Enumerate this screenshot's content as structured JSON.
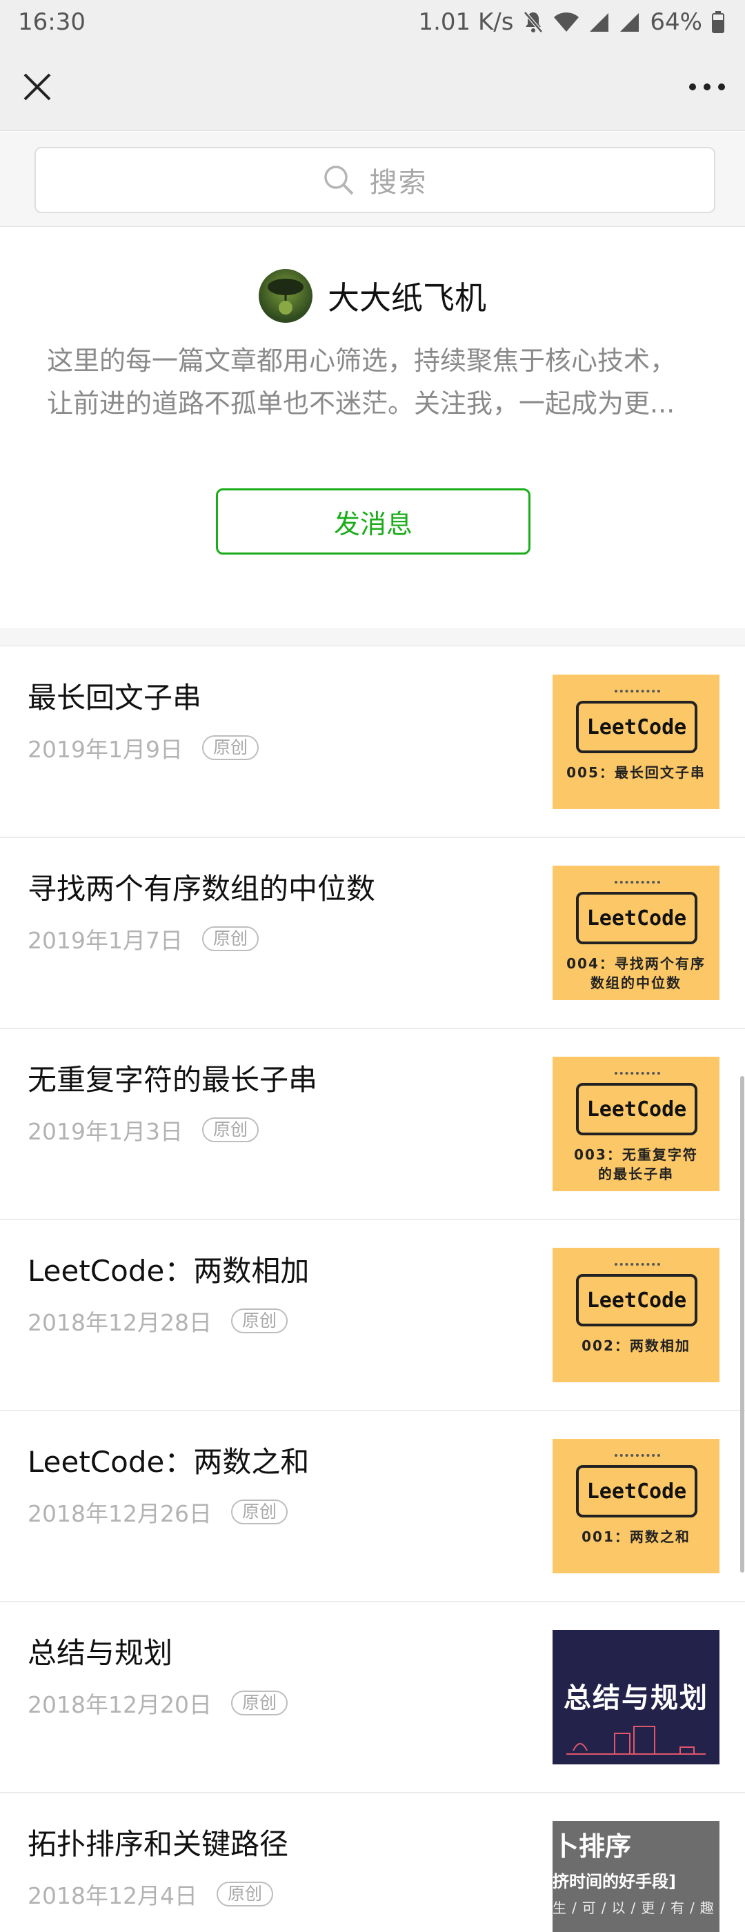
{
  "status_bar": {
    "time": "16:30",
    "network_speed": "1.01 K/s",
    "battery": "64%"
  },
  "nav": {
    "close_icon": "close-icon",
    "more_icon": "more-icon"
  },
  "search": {
    "placeholder": "搜索"
  },
  "profile": {
    "name": "大大纸飞机",
    "description_line1": "这里的每一篇文章都用心筛选，持续聚焦于核心技术，",
    "description_line2": "让前进的道路不孤单也不迷茫。关注我，一起成为更...",
    "message_button": "发消息",
    "accent_color": "#1aad19"
  },
  "articles": [
    {
      "title": "最长回文子串",
      "date": "2019年1月9日",
      "badge": "原创",
      "thumb": {
        "logo": "LeetCode",
        "caption_line1": "005：最长回文子串",
        "caption_line2": ""
      }
    },
    {
      "title": "寻找两个有序数组的中位数",
      "date": "2019年1月7日",
      "badge": "原创",
      "thumb": {
        "logo": "LeetCode",
        "caption_line1": "004：寻找两个有序",
        "caption_line2": "数组的中位数"
      }
    },
    {
      "title": "无重复字符的最长子串",
      "date": "2019年1月3日",
      "badge": "原创",
      "thumb": {
        "logo": "LeetCode",
        "caption_line1": "003：无重复字符",
        "caption_line2": "的最长子串"
      }
    },
    {
      "title": "LeetCode：两数相加",
      "date": "2018年12月28日",
      "badge": "原创",
      "thumb": {
        "logo": "LeetCode",
        "caption_line1": "002：两数相加",
        "caption_line2": ""
      }
    },
    {
      "title": "LeetCode：两数之和",
      "date": "2018年12月26日",
      "badge": "原创",
      "thumb": {
        "logo": "LeetCode",
        "caption_line1": "001：两数之和",
        "caption_line2": ""
      }
    },
    {
      "title": "总结与规划",
      "date": "2018年12月20日",
      "badge": "原创",
      "thumb": {
        "text": "总结与规划"
      }
    },
    {
      "title": "拓扑排序和关键路径",
      "date": "2018年12月4日",
      "badge": "原创",
      "thumb": {
        "text1": "卜排序",
        "text2": "挤时间的好手段]",
        "text3": "生/可/以/更/有/趣"
      }
    }
  ]
}
